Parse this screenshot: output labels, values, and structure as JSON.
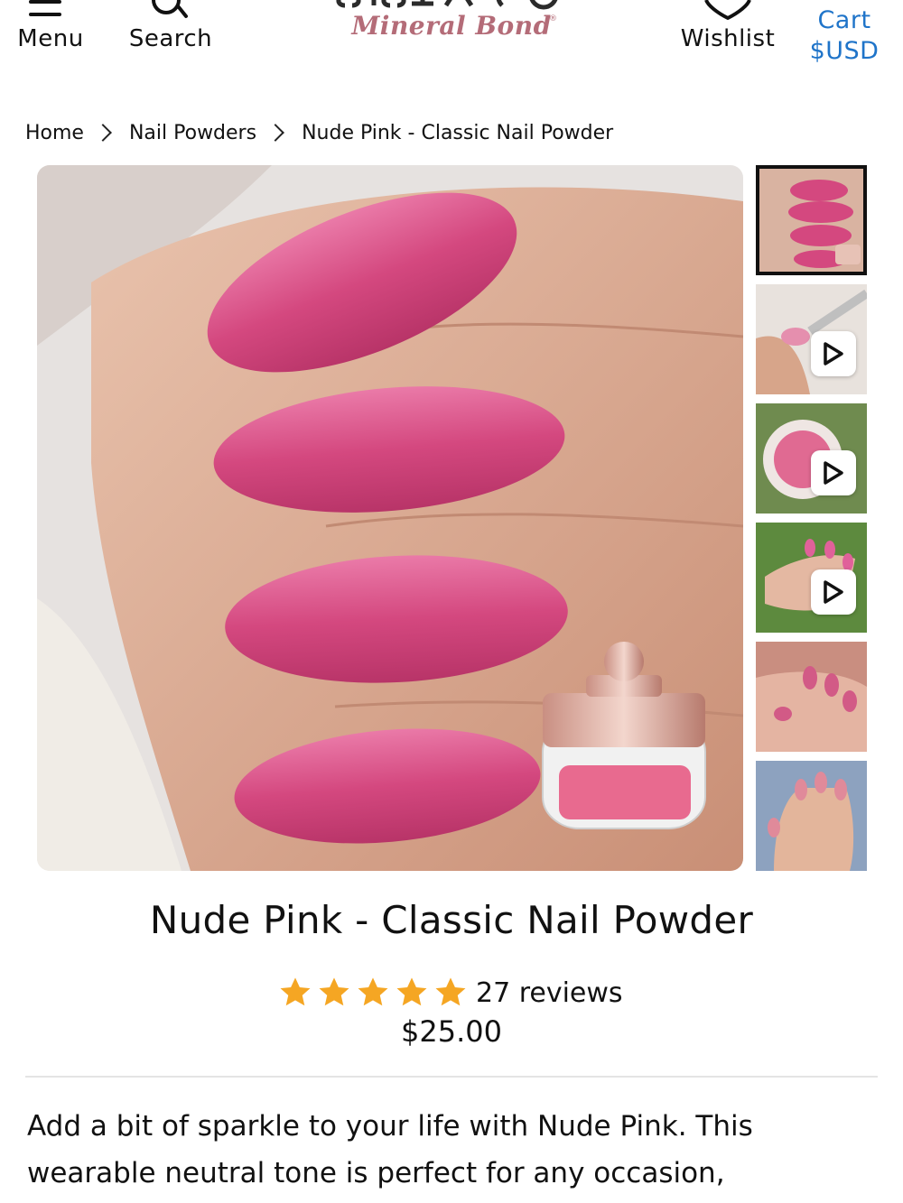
{
  "header": {
    "menu_label": "Menu",
    "search_label": "Search",
    "logo_sub": "Mineral Bond",
    "wishlist_label": "Wishlist",
    "cart_label": "Cart",
    "currency_label": "$USD"
  },
  "breadcrumb": {
    "items": [
      "Home",
      "Nail Powders",
      "Nude Pink - Classic Nail Powder"
    ]
  },
  "product": {
    "title": "Nude Pink - Classic Nail Powder",
    "rating": 5,
    "reviews_label": "27 reviews",
    "price": "$25.00",
    "description": "Add a bit of sparkle to your life with Nude Pink. This wearable neutral tone is perfect for any occasion,"
  },
  "gallery": {
    "thumbnail_count": 6,
    "active_index": 0,
    "video_thumbnails": [
      1,
      2,
      3
    ]
  },
  "colors": {
    "accent_link": "#1f74c9",
    "logo_pink": "#b46c78",
    "star": "#f5a623",
    "nail_pink": "#d9538f"
  },
  "icons": {
    "menu": "hamburger-icon",
    "search": "search-icon",
    "wishlist": "heart-icon",
    "play": "play-icon",
    "chevron": "chevron-right-icon",
    "star": "star-icon"
  }
}
